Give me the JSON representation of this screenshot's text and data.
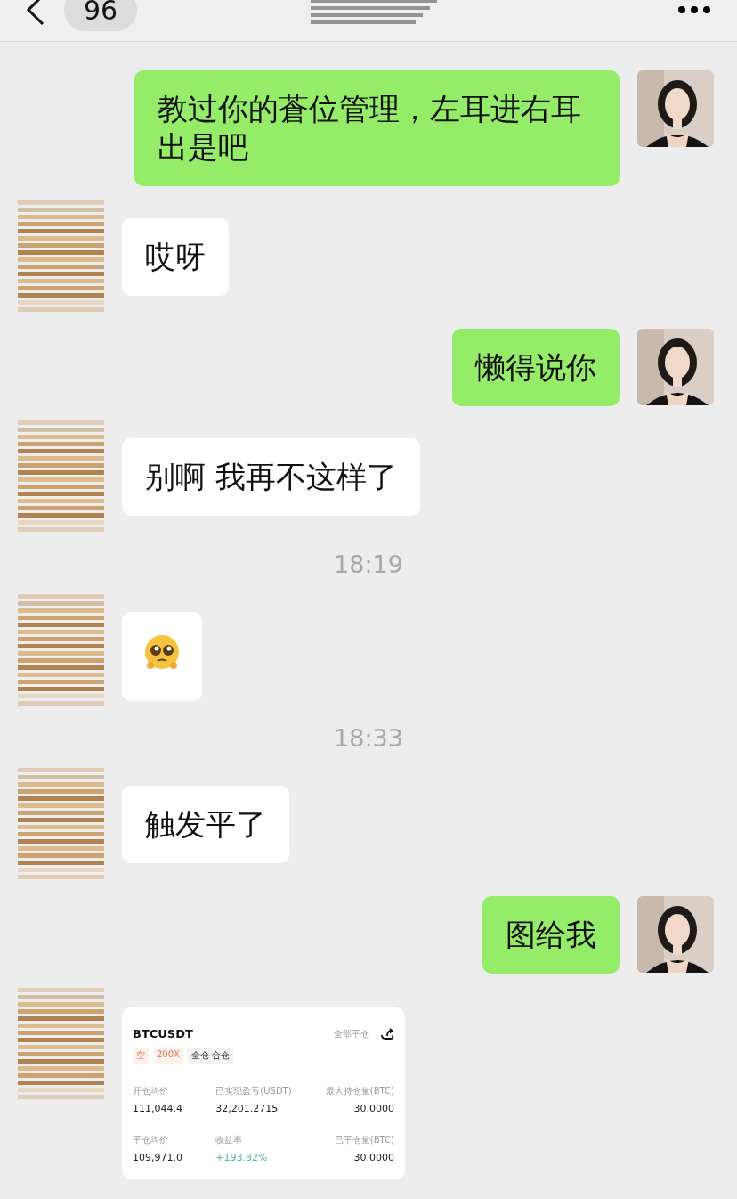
{
  "header": {
    "unread_count": "96"
  },
  "messages": [
    {
      "kind": "text",
      "sent": true,
      "text": "教过你的蒼位管理，左耳进右耳出是吧"
    },
    {
      "kind": "text",
      "sent": false,
      "text": "哎呀"
    },
    {
      "kind": "text",
      "sent": true,
      "text": "懒得说你"
    },
    {
      "kind": "text",
      "sent": false,
      "text": "别啊 我再不这样了"
    },
    {
      "kind": "time",
      "text": "18:19"
    },
    {
      "kind": "sticker",
      "sent": false
    },
    {
      "kind": "time",
      "text": "18:33"
    },
    {
      "kind": "text",
      "sent": false,
      "text": "触发平了"
    },
    {
      "kind": "text",
      "sent": true,
      "text": "图给我"
    },
    {
      "kind": "card",
      "sent": false,
      "symbol": "BTCUSDT",
      "action": "全部平仓",
      "tags": [
        {
          "kind": "direction",
          "text": "空"
        },
        {
          "kind": "leverage",
          "text": "200X"
        },
        {
          "kind": "margin",
          "text": "全仓 合仓"
        }
      ],
      "fields": [
        {
          "label": "开仓均价",
          "value": "111,044.4",
          "positive": false
        },
        {
          "label": "已实现盈亏(USDT)",
          "value": "32,201.2715",
          "positive": false
        },
        {
          "label": "最大持仓量(BTC)",
          "value": "30.0000",
          "positive": false
        },
        {
          "label": "平仓均价",
          "value": "109,971.0",
          "positive": false
        },
        {
          "label": "收益率",
          "value": "+193.32%",
          "positive": true
        },
        {
          "label": "已平仓量(BTC)",
          "value": "30.0000",
          "positive": false
        }
      ]
    }
  ]
}
